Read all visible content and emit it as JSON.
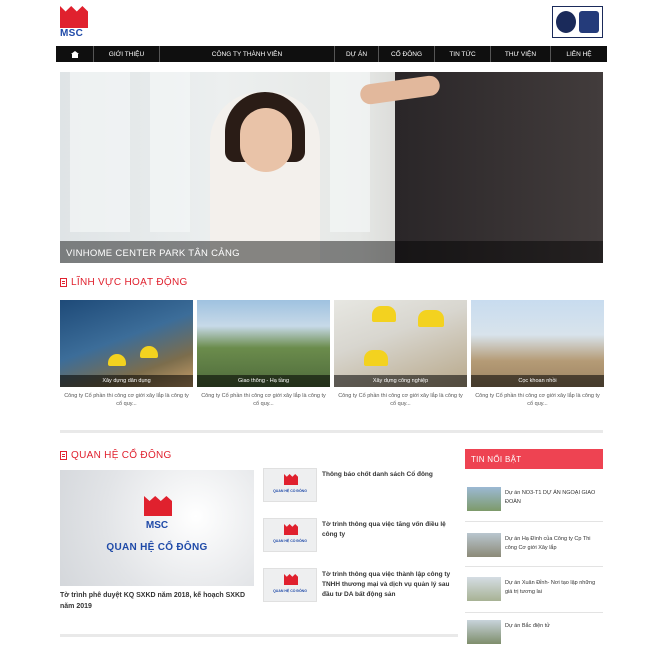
{
  "brand": {
    "logo_text": "MSC",
    "accent": "#e0212e",
    "logo_blue": "#1f4aa8"
  },
  "nav": {
    "home_icon": "home-icon",
    "items": [
      "Giới thiệu",
      "Công ty thành viên",
      "Dự án",
      "Cổ đông",
      "Tin tức",
      "Thư viện",
      "Liên hệ"
    ]
  },
  "hero": {
    "caption": "VINHOME CENTER PARK TÂN CẢNG"
  },
  "activities": {
    "title": "LĨNH VỰC HOẠT ĐỘNG",
    "cards": [
      {
        "label": "Xây dựng dân dụng",
        "desc": "Công ty Cổ phần thi công cơ giới xây lắp là công ty cổ quy..."
      },
      {
        "label": "Giao thông - Hạ tầng",
        "desc": "Công ty Cổ phần thi công cơ giới xây lắp là công ty cổ quy..."
      },
      {
        "label": "Xây dựng công nghiệp",
        "desc": "Công ty Cổ phần thi công cơ giới xây lắp là công ty cổ quy..."
      },
      {
        "label": "Cọc khoan nhồi",
        "desc": "Công ty Cổ phần thi công cơ giới xây lắp là công ty cổ quy..."
      }
    ]
  },
  "shareholders": {
    "title": "QUAN HỆ CỔ ĐÔNG",
    "feature_logo": "MSC",
    "feature_banner": "QUAN HỆ CỔ ĐÔNG",
    "feature_caption": "Tờ trình phê duyệt KQ SXKD năm 2018, kế hoạch SXKD năm 2019",
    "thumb_text": "QUAN HỆ CỔ ĐÔNG",
    "news": [
      "Thông báo chốt danh sách Cổ đông",
      "Tờ trình thông qua việc tăng vốn điều lệ công ty",
      "Tờ trình thông qua việc thành lập công ty TNHH thương mại và dịch vụ quản lý sau đầu tư DA bất động sản"
    ]
  },
  "hot_news": {
    "title": "TIN NỔI BẬT",
    "items": [
      "Dự án NO3-T1 DỰ ÁN NGOẠI GIAO ĐOÀN",
      "Dự án Hạ Đình của Công ty Cp Thi công Cơ giới Xây lắp",
      "Dự án Xuân Đỉnh- Nơi tạo lập những giá trị tương lai",
      "Dự án Bắc điện tử"
    ]
  }
}
